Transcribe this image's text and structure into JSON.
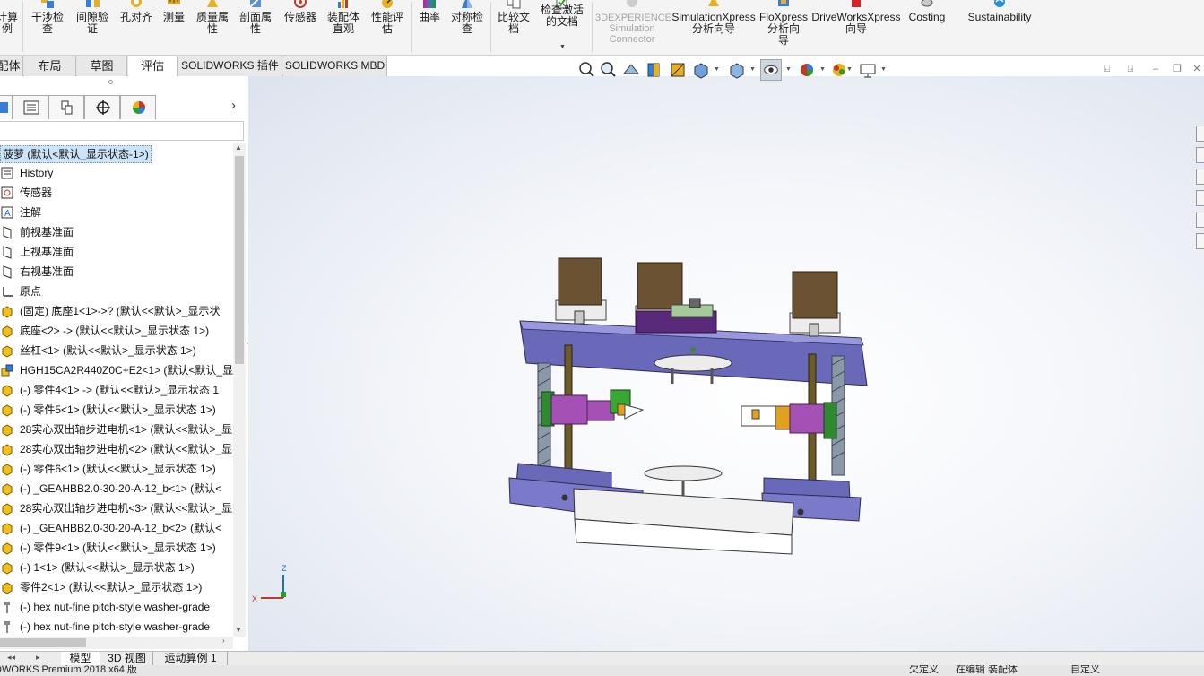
{
  "ribbon": {
    "buttons": [
      {
        "id": "calc",
        "label": "计算\n例"
      },
      {
        "id": "interference",
        "label": "干涉检\n查"
      },
      {
        "id": "clearance",
        "label": "间隙验\n证"
      },
      {
        "id": "hole_align",
        "label": "孔对齐"
      },
      {
        "id": "measure",
        "label": "测量"
      },
      {
        "id": "mass_props",
        "label": "质量属\n性"
      },
      {
        "id": "section_props",
        "label": "剖面属\n性"
      },
      {
        "id": "sensor",
        "label": "传感器"
      },
      {
        "id": "assembly_visual",
        "label": "装配体\n直观"
      },
      {
        "id": "perf_eval",
        "label": "性能评\n估"
      },
      {
        "id": "curvature",
        "label": "曲率"
      },
      {
        "id": "symmetry",
        "label": "对称检\n查"
      },
      {
        "id": "compare_docs",
        "label": "比较文\n档"
      },
      {
        "id": "check_active",
        "label": "检查激活\n的文档"
      },
      {
        "id": "sim_connector",
        "label": "3DEXPERIENCE\nSimulation\nConnector"
      },
      {
        "id": "simxpress",
        "label": "SimulationXpress\n分析向导"
      },
      {
        "id": "floxpress",
        "label": "FloXpress\n分析向\n导"
      },
      {
        "id": "driveworks",
        "label": "DriveWorksXpress\n向导"
      },
      {
        "id": "costing",
        "label": "Costing"
      },
      {
        "id": "sustainability",
        "label": "Sustainability"
      }
    ]
  },
  "command_tabs": [
    {
      "label": "配体",
      "active": false
    },
    {
      "label": "布局",
      "active": false
    },
    {
      "label": "草图",
      "active": false
    },
    {
      "label": "评估",
      "active": true
    },
    {
      "label": "SOLIDWORKS 插件",
      "active": false
    },
    {
      "label": "SOLIDWORKS MBD",
      "active": false
    }
  ],
  "view_toolbar": {
    "icons": [
      "zoom-to-fit-icon",
      "zoom-area-icon",
      "previous-view-icon",
      "section-view-icon",
      "dynamic-annotation-icon",
      "view-orientation-icon",
      "display-style-icon",
      "hide-show-items-icon",
      "edit-appearance-icon",
      "apply-scene-icon",
      "view-settings-icon"
    ]
  },
  "feature_tree": {
    "root": "菠萝 (默认<默认_显示状态-1>)",
    "items": [
      {
        "icon": "history-icon",
        "label": "History"
      },
      {
        "icon": "sensor-icon",
        "label": "传感器"
      },
      {
        "icon": "annotation-icon",
        "label": "注解"
      },
      {
        "icon": "plane-icon",
        "label": "前视基准面"
      },
      {
        "icon": "plane-icon",
        "label": "上视基准面"
      },
      {
        "icon": "plane-icon",
        "label": "右视基准面"
      },
      {
        "icon": "origin-icon",
        "label": "原点"
      },
      {
        "icon": "part-icon",
        "label": "(固定) 底座1<1>->? (默认<<默认>_显示状"
      },
      {
        "icon": "part-icon",
        "label": "底座<2> -> (默认<<默认>_显示状态 1>)"
      },
      {
        "icon": "part-icon",
        "label": "丝杠<1> (默认<<默认>_显示状态 1>)"
      },
      {
        "icon": "subassembly-icon",
        "label": "HGH15CA2R440Z0C+E2<1> (默认<默认_显"
      },
      {
        "icon": "part-icon",
        "label": "(-) 零件4<1> -> (默认<<默认>_显示状态 1"
      },
      {
        "icon": "part-icon",
        "label": "(-) 零件5<1> (默认<<默认>_显示状态 1>)"
      },
      {
        "icon": "part-icon",
        "label": "28实心双出轴步进电机<1> (默认<<默认>_显"
      },
      {
        "icon": "part-icon",
        "label": "28实心双出轴步进电机<2> (默认<<默认>_显"
      },
      {
        "icon": "part-icon",
        "label": "(-) 零件6<1> (默认<<默认>_显示状态 1>)"
      },
      {
        "icon": "part-icon",
        "label": "(-) _GEAHBB2.0-30-20-A-12_b<1> (默认<"
      },
      {
        "icon": "part-icon",
        "label": "28实心双出轴步进电机<3> (默认<<默认>_显"
      },
      {
        "icon": "part-icon",
        "label": "(-) _GEAHBB2.0-30-20-A-12_b<2> (默认<"
      },
      {
        "icon": "part-icon",
        "label": "(-) 零件9<1> (默认<<默认>_显示状态 1>)"
      },
      {
        "icon": "part-icon",
        "label": "(-) 1<1> (默认<<默认>_显示状态 1>)"
      },
      {
        "icon": "part-icon",
        "label": "零件2<1> (默认<<默认>_显示状态 1>)"
      },
      {
        "icon": "toolbox-icon",
        "label": "(-) hex nut-fine pitch-style washer-grade"
      },
      {
        "icon": "toolbox-icon",
        "label": "(-) hex nut-fine pitch-style washer-grade"
      }
    ]
  },
  "triad": {
    "x": "X",
    "z": "Z"
  },
  "bottom_tabs": [
    {
      "label": "模型",
      "active": true
    },
    {
      "label": "3D 视图",
      "active": false
    },
    {
      "label": "运动算例 1",
      "active": false
    }
  ],
  "status": {
    "product": "DWORKS Premium 2018 x64 版",
    "defined": "欠定义",
    "editing": "在编辑 装配体",
    "custom": "自定义"
  },
  "colors": {
    "frame_purple": "#7b79c9",
    "motor_brown": "#6b5233",
    "carriage_magenta": "#a450b5",
    "bracket_green": "#38a832",
    "accent_blue": "#1e6fbf"
  }
}
